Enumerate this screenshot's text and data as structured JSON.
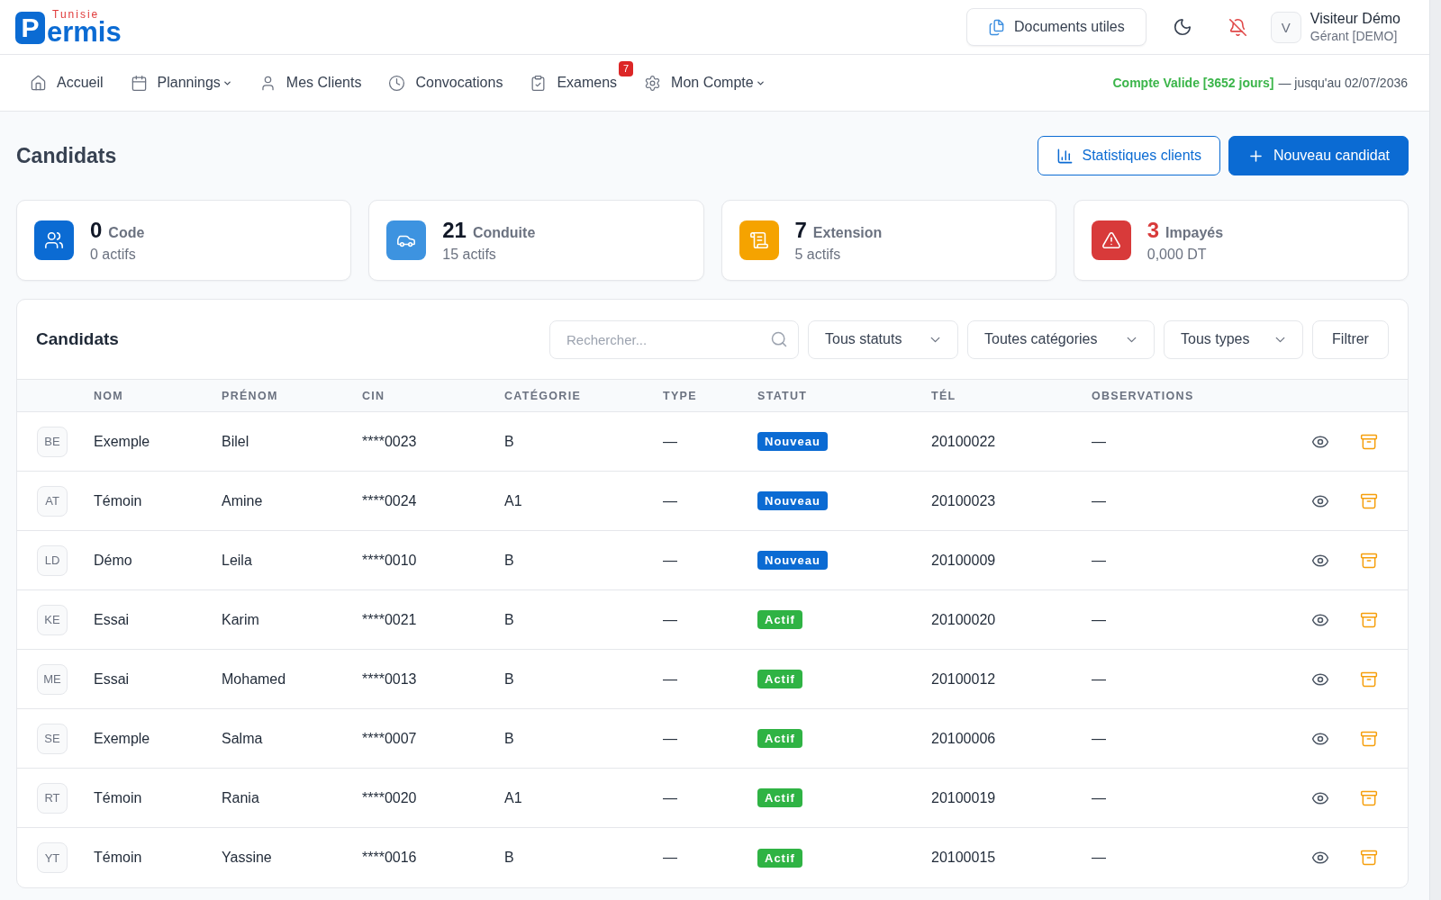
{
  "logo": {
    "tagline": "Tunisie",
    "mark": "P",
    "rest": "ermis"
  },
  "header": {
    "documents_button": "Documents utiles",
    "user": {
      "initial": "V",
      "name": "Visiteur Démo",
      "role": "Gérant [DEMO]"
    }
  },
  "nav": {
    "items": [
      {
        "label": "Accueil",
        "dropdown": false
      },
      {
        "label": "Plannings",
        "dropdown": true
      },
      {
        "label": "Mes Clients",
        "dropdown": false
      },
      {
        "label": "Convocations",
        "dropdown": false
      },
      {
        "label": "Examens",
        "dropdown": false,
        "badge": "7"
      },
      {
        "label": "Mon Compte",
        "dropdown": true
      }
    ],
    "account_status": "Compte Valide [3652 jours]",
    "expiry": "— jusqu'au 02/07/2036"
  },
  "page": {
    "title": "Candidats",
    "buttons": [
      {
        "label": "Statistiques clients",
        "kind": "outline"
      },
      {
        "label": "Nouveau candidat",
        "kind": "primary"
      }
    ]
  },
  "cards": [
    {
      "value": "0",
      "label": "Code",
      "sub": "0 actifs",
      "color": "#0b6bd3",
      "alert": false
    },
    {
      "value": "21",
      "label": "Conduite",
      "sub": "15 actifs",
      "color": "#3d93e0",
      "alert": false
    },
    {
      "value": "7",
      "label": "Extension",
      "sub": "5 actifs",
      "color": "#f5a300",
      "alert": false
    },
    {
      "value": "3",
      "label": "Impayés",
      "sub": "0,000 DT",
      "color": "#d83a3a",
      "alert": true
    }
  ],
  "panel": {
    "title": "Candidats",
    "search": {
      "placeholder": "Rechercher..."
    },
    "filters": [
      "Tous statuts",
      "Toutes catégories",
      "Tous types"
    ],
    "filter_button": "Filtrer"
  },
  "table": {
    "columns": [
      "NOM",
      "PRÉNOM",
      "CIN",
      "CATÉGORIE",
      "TYPE",
      "STATUT",
      "TÉL",
      "OBSERVATIONS"
    ],
    "rows": [
      {
        "initials": "BE",
        "nom": "Exemple",
        "prenom": "Bilel",
        "cin": "****0023",
        "categorie": "B",
        "type": "—",
        "status": {
          "label": "Nouveau",
          "color": "#0b6bd3"
        },
        "tel": "20100022",
        "observations": "—"
      },
      {
        "initials": "AT",
        "nom": "Témoin",
        "prenom": "Amine",
        "cin": "****0024",
        "categorie": "A1",
        "type": "—",
        "status": {
          "label": "Nouveau",
          "color": "#0b6bd3"
        },
        "tel": "20100023",
        "observations": "—"
      },
      {
        "initials": "LD",
        "nom": "Démo",
        "prenom": "Leila",
        "cin": "****0010",
        "categorie": "B",
        "type": "—",
        "status": {
          "label": "Nouveau",
          "color": "#0b6bd3"
        },
        "tel": "20100009",
        "observations": "—"
      },
      {
        "initials": "KE",
        "nom": "Essai",
        "prenom": "Karim",
        "cin": "****0021",
        "categorie": "B",
        "type": "—",
        "status": {
          "label": "Actif",
          "color": "#2fb344"
        },
        "tel": "20100020",
        "observations": "—"
      },
      {
        "initials": "ME",
        "nom": "Essai",
        "prenom": "Mohamed",
        "cin": "****0013",
        "categorie": "B",
        "type": "—",
        "status": {
          "label": "Actif",
          "color": "#2fb344"
        },
        "tel": "20100012",
        "observations": "—"
      },
      {
        "initials": "SE",
        "nom": "Exemple",
        "prenom": "Salma",
        "cin": "****0007",
        "categorie": "B",
        "type": "—",
        "status": {
          "label": "Actif",
          "color": "#2fb344"
        },
        "tel": "20100006",
        "observations": "—"
      },
      {
        "initials": "RT",
        "nom": "Témoin",
        "prenom": "Rania",
        "cin": "****0020",
        "categorie": "A1",
        "type": "—",
        "status": {
          "label": "Actif",
          "color": "#2fb344"
        },
        "tel": "20100019",
        "observations": "—"
      },
      {
        "initials": "YT",
        "nom": "Témoin",
        "prenom": "Yassine",
        "cin": "****0016",
        "categorie": "B",
        "type": "—",
        "status": {
          "label": "Actif",
          "color": "#2fb344"
        },
        "tel": "20100015",
        "observations": "—"
      }
    ]
  }
}
